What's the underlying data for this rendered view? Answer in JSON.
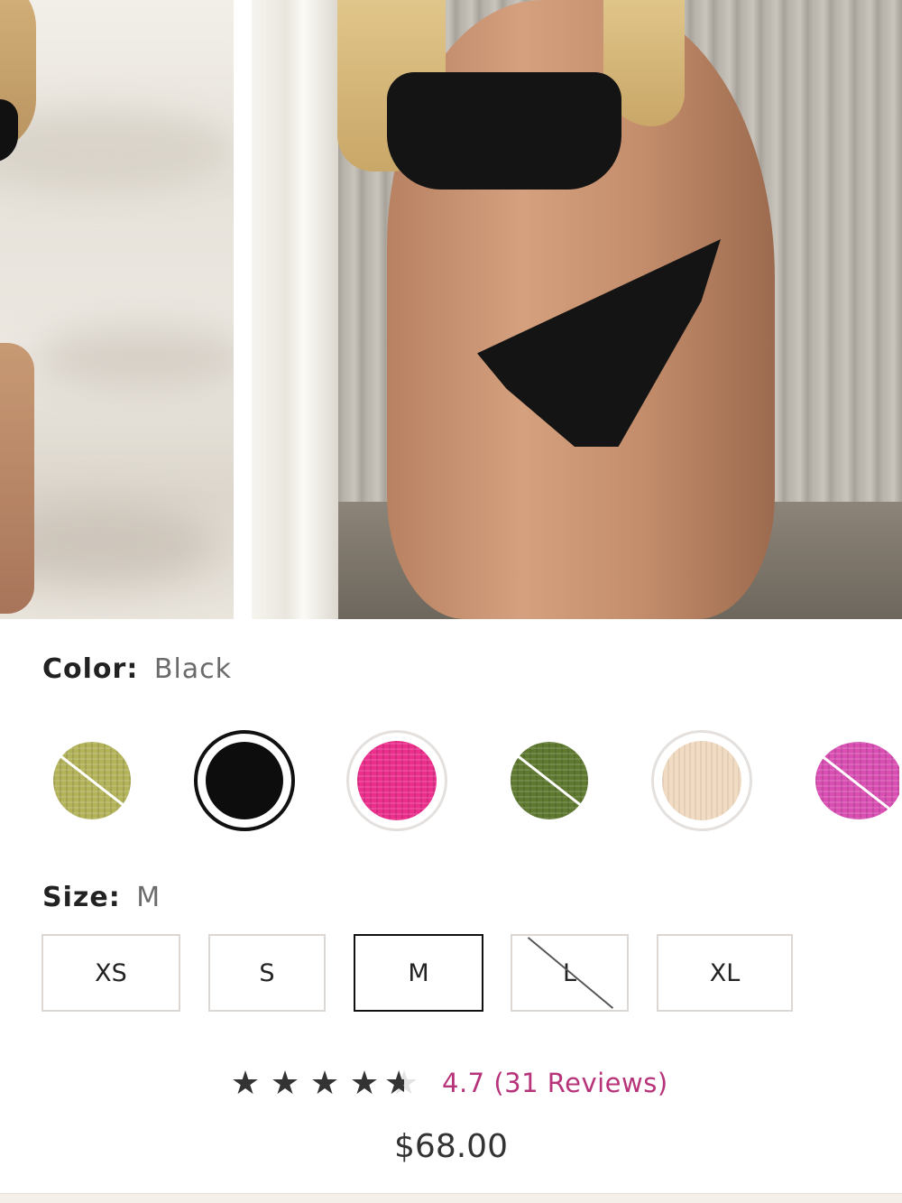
{
  "colors": {
    "label": "Color:",
    "selected": "Black",
    "swatches": [
      {
        "name": "olive",
        "color": "#b3b35a",
        "available": false,
        "texture": "knit"
      },
      {
        "name": "black",
        "color": "#0d0d0d",
        "available": true,
        "selected": true,
        "texture": "none"
      },
      {
        "name": "pink",
        "color": "#ec2f8c",
        "available": true,
        "texture": "knit"
      },
      {
        "name": "khaki-green",
        "color": "#5f7a30",
        "available": false,
        "texture": "knit"
      },
      {
        "name": "cream",
        "color": "#f1dcc3",
        "available": true,
        "texture": "rib"
      },
      {
        "name": "orchid",
        "color": "#d94fb3",
        "available": false,
        "texture": "knit"
      }
    ]
  },
  "sizes": {
    "label": "Size:",
    "selected": "M",
    "options": [
      {
        "label": "XS",
        "available": true
      },
      {
        "label": "S",
        "available": true
      },
      {
        "label": "M",
        "available": true,
        "selected": true
      },
      {
        "label": "L",
        "available": false
      },
      {
        "label": "XL",
        "available": true
      }
    ]
  },
  "rating": {
    "value": 4.7,
    "text": "4.7 (31 Reviews)",
    "star_color": "#333333",
    "text_color": "#b7337a"
  },
  "price": "$68.00"
}
